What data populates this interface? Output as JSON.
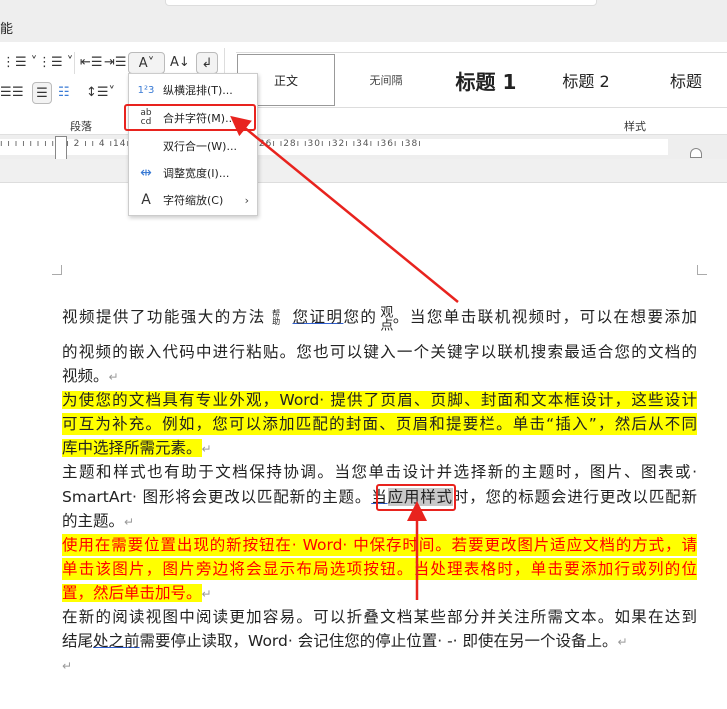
{
  "title_area": {
    "tab_fragment": "能"
  },
  "ribbon": {
    "groups": {
      "paragraph": "段落",
      "styles": "样式"
    },
    "styles": [
      {
        "label": "正文"
      },
      {
        "label": "无间隔"
      },
      {
        "label": "标题 1"
      },
      {
        "label": "标题 2"
      },
      {
        "label": "标题"
      }
    ]
  },
  "ruler": {
    "ticks": "ı ı ı ı ı ı ı ı ı   ı 2 ı   ı 4                                 ı14ı   ı16ı   ı18ı   ı20ı   ı22ı   ı24ı   ı26ı   ı28ı   ı30ı   ı32ı   ı34ı   ı36ı   ı38ı"
  },
  "menu": {
    "items": [
      {
        "icon": "1²3",
        "label": "纵横混排(T)...",
        "icon_name": "vertical-horizontal-icon"
      },
      {
        "icon": "ab cd",
        "label": "合并字符(M)...",
        "icon_name": "combine-characters-icon"
      },
      {
        "icon": "",
        "label": "双行合一(W)..."
      },
      {
        "icon": "⇹",
        "label": "调整宽度(I)...",
        "icon_name": "fit-width-icon"
      },
      {
        "icon": "A",
        "label": "字符缩放(C)",
        "icon_name": "char-scale-icon",
        "submenu": true
      }
    ]
  },
  "document": {
    "p1": {
      "a": "视频提供了功能强大的方法",
      "merged": "帮助",
      "b": "您证明",
      "c": "您的",
      "vertical": "观点",
      "d": "。当您单击联机视频时，可以在想要添加",
      "l2": "的视频的嵌入代码中进行粘贴。您也可以键入一个关键字以联机搜索最适合您的文档的",
      "l3": "视频。"
    },
    "p2": {
      "l1": "为使您的文档具有专业外观，Word· 提供了页眉、页脚、封面和文本框设计，这些设计",
      "l2": "可互为补充。例如，您可以添加匹配的封面、页眉和提要栏。单击“插入”，然后从不同",
      "l3": "库中选择所需元素。"
    },
    "p3": {
      "l1": "主题和样式也有助于文档保持协调。当您单击设计并选择新的主题时，图片、图表或·",
      "l2a": "SmartArt· 图形将会更改以匹配新的主题。",
      "l2u": "当",
      "l2s": "应用样式",
      "l2b": "时，您的标题会进行更改以匹配新",
      "l3": "的主题。"
    },
    "p4": {
      "l1": "使用在需要位置出现的新按钮在· Word· 中保存时间。若要更改图片适应文档的方式，请",
      "l2": "单击该图片，图片旁边将会显示布局选项按钮。当处理表格时，单击要添加行或列的位",
      "l3": "置，然后单击加号。"
    },
    "p5": {
      "l1": "在新的阅读视图中阅读更加容易。可以折叠文档某些部分并关注所需文本。如果在达到",
      "l2a": "结尾",
      "l2u": "处之前",
      "l2b": "需要停止读取，Word· 会记住您的停止位置· -· 即使在另一个设备上。"
    },
    "para_mark": "↵"
  },
  "colors": {
    "highlight": "#ffff00",
    "red_text": "#ff0000",
    "annotation": "#e8231e"
  }
}
